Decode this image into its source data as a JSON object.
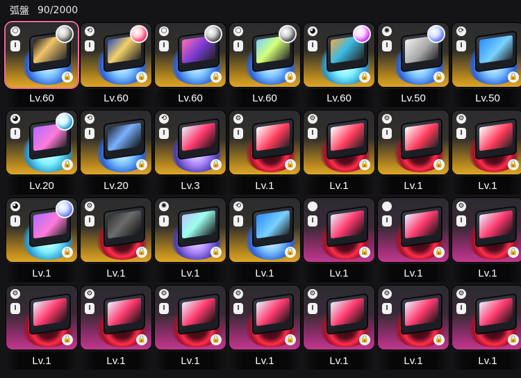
{
  "header": {
    "title": "弧盤",
    "count": "90/2000"
  },
  "icons": {
    "lock_glyph": "🔒",
    "rarity_label": "I",
    "type_glyphs": [
      "◆",
      "✺",
      "⚙",
      "⟲",
      "⟳"
    ]
  },
  "cards": [
    {
      "level": "Lv.60",
      "frame": "gold",
      "selected": true,
      "type_glyph": "⬡",
      "avatar": "a3",
      "screen": "s1",
      "disc": "blue"
    },
    {
      "level": "Lv.60",
      "frame": "gold",
      "selected": false,
      "type_glyph": "⟲",
      "avatar": "a2",
      "screen": "s2",
      "disc": "blue"
    },
    {
      "level": "Lv.60",
      "frame": "gold",
      "selected": false,
      "type_glyph": "⬡",
      "avatar": "a3",
      "screen": "s3",
      "disc": "blue"
    },
    {
      "level": "Lv.60",
      "frame": "gold",
      "selected": false,
      "type_glyph": "⬡",
      "avatar": "a3",
      "screen": "s4",
      "disc": "blue"
    },
    {
      "level": "Lv.60",
      "frame": "gold",
      "selected": false,
      "type_glyph": "◕",
      "avatar": "a5",
      "screen": "s5",
      "disc": "cyan"
    },
    {
      "level": "Lv.50",
      "frame": "gold",
      "selected": false,
      "type_glyph": "✺",
      "avatar": "a1",
      "screen": "s6",
      "disc": "blue"
    },
    {
      "level": "Lv.50",
      "frame": "gold",
      "selected": false,
      "type_glyph": "⟳",
      "avatar": "none",
      "screen": "s7",
      "disc": "blue"
    },
    {
      "level": "Lv.20",
      "frame": "gold",
      "selected": false,
      "type_glyph": "◕",
      "avatar": "a4",
      "screen": "s8",
      "disc": "cyan"
    },
    {
      "level": "Lv.20",
      "frame": "gold",
      "selected": false,
      "type_glyph": "⟲",
      "avatar": "none",
      "screen": "s10",
      "disc": "blue"
    },
    {
      "level": "Lv.3",
      "frame": "gold",
      "selected": false,
      "type_glyph": "⟲",
      "avatar": "none",
      "screen": "s11",
      "disc": "purple"
    },
    {
      "level": "Lv.1",
      "frame": "gold",
      "selected": false,
      "type_glyph": "⚙",
      "avatar": "none",
      "screen": "s9",
      "disc": "red"
    },
    {
      "level": "Lv.1",
      "frame": "gold",
      "selected": false,
      "type_glyph": "⚙",
      "avatar": "none",
      "screen": "s9",
      "disc": "red"
    },
    {
      "level": "Lv.1",
      "frame": "gold",
      "selected": false,
      "type_glyph": "⚙",
      "avatar": "none",
      "screen": "s9",
      "disc": "red"
    },
    {
      "level": "Lv.1",
      "frame": "gold",
      "selected": false,
      "type_glyph": "⚙",
      "avatar": "none",
      "screen": "s9",
      "disc": "red"
    },
    {
      "level": "Lv.1",
      "frame": "gold",
      "selected": false,
      "type_glyph": "◕",
      "avatar": "a1",
      "screen": "s8",
      "disc": "cyan"
    },
    {
      "level": "Lv.1",
      "frame": "gold",
      "selected": false,
      "type_glyph": "⚙",
      "avatar": "none",
      "screen": "s12",
      "disc": "red"
    },
    {
      "level": "Lv.1",
      "frame": "gold",
      "selected": false,
      "type_glyph": "✺",
      "avatar": "none",
      "screen": "s13",
      "disc": "purple"
    },
    {
      "level": "Lv.1",
      "frame": "gold",
      "selected": false,
      "type_glyph": "⟲",
      "avatar": "none",
      "screen": "s7",
      "disc": "blue"
    },
    {
      "level": "Lv.1",
      "frame": "pink",
      "selected": false,
      "type_glyph": "",
      "avatar": "none",
      "screen": "s11",
      "disc": "red"
    },
    {
      "level": "Lv.1",
      "frame": "pink",
      "selected": false,
      "type_glyph": "",
      "avatar": "none",
      "screen": "s11",
      "disc": "red"
    },
    {
      "level": "Lv.1",
      "frame": "pink",
      "selected": false,
      "type_glyph": "⚙",
      "avatar": "none",
      "screen": "s11",
      "disc": "red"
    },
    {
      "level": "Lv.1",
      "frame": "pink",
      "selected": false,
      "type_glyph": "⚙",
      "avatar": "none",
      "screen": "s11",
      "disc": "red"
    },
    {
      "level": "Lv.1",
      "frame": "pink",
      "selected": false,
      "type_glyph": "⚙",
      "avatar": "none",
      "screen": "s11",
      "disc": "red"
    },
    {
      "level": "Lv.1",
      "frame": "pink",
      "selected": false,
      "type_glyph": "⚙",
      "avatar": "none",
      "screen": "s11",
      "disc": "red"
    },
    {
      "level": "Lv.1",
      "frame": "pink",
      "selected": false,
      "type_glyph": "⚙",
      "avatar": "none",
      "screen": "s11",
      "disc": "red"
    },
    {
      "level": "Lv.1",
      "frame": "pink",
      "selected": false,
      "type_glyph": "⚙",
      "avatar": "none",
      "screen": "s11",
      "disc": "red"
    },
    {
      "level": "Lv.1",
      "frame": "pink",
      "selected": false,
      "type_glyph": "⚙",
      "avatar": "none",
      "screen": "s11",
      "disc": "red"
    },
    {
      "level": "Lv.1",
      "frame": "pink",
      "selected": false,
      "type_glyph": "⚙",
      "avatar": "none",
      "screen": "s11",
      "disc": "red"
    }
  ]
}
